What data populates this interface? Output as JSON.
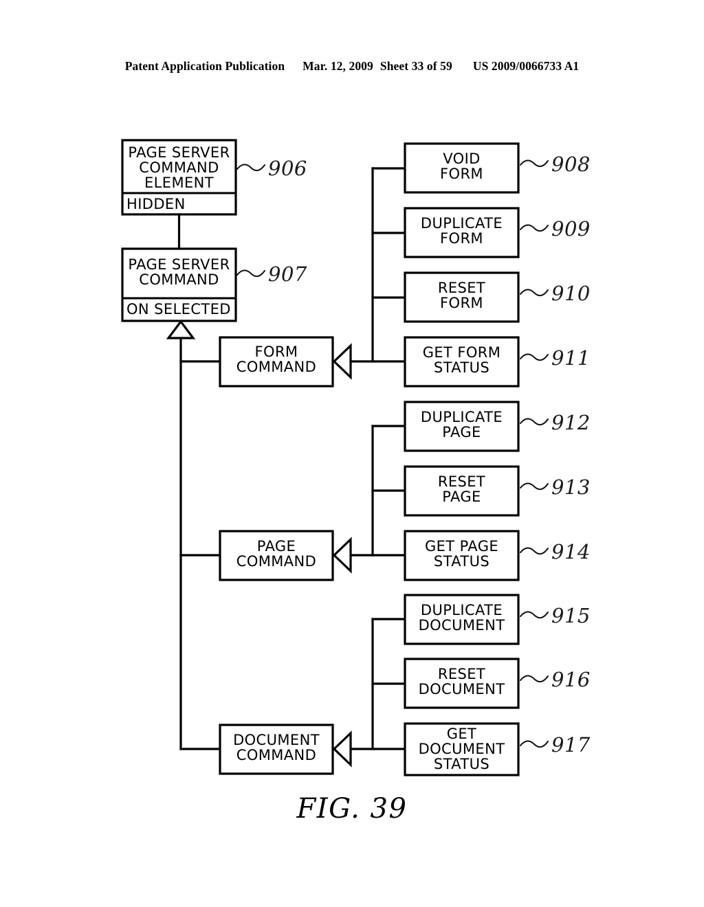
{
  "header": {
    "publication": "Patent Application Publication",
    "date": "Mar. 12, 2009",
    "sheet": "Sheet 33 of 59",
    "patent_number": "US 2009/0066733 A1"
  },
  "figure": {
    "caption": "FIG. 39"
  },
  "diagram": {
    "type": "uml-class-diagram",
    "classes": [
      {
        "id": "906",
        "name": "PAGE SERVER\nCOMMAND\nELEMENT",
        "name_lines": [
          "PAGE SERVER",
          "COMMAND",
          "ELEMENT"
        ],
        "attributes": [
          "HIDDEN"
        ],
        "ref": "906"
      },
      {
        "id": "907",
        "name": "PAGE SERVER\nCOMMAND",
        "name_lines": [
          "PAGE SERVER",
          "COMMAND"
        ],
        "attributes": [
          "ON SELECTED"
        ],
        "ref": "907"
      }
    ],
    "command_groups": [
      {
        "parent_label_lines": [
          "FORM",
          "COMMAND"
        ],
        "parent_name": "FORM COMMAND",
        "children": [
          {
            "ref": "908",
            "label_lines": [
              "VOID",
              "FORM"
            ],
            "label": "VOID FORM"
          },
          {
            "ref": "909",
            "label_lines": [
              "DUPLICATE",
              "FORM"
            ],
            "label": "DUPLICATE FORM"
          },
          {
            "ref": "910",
            "label_lines": [
              "RESET",
              "FORM"
            ],
            "label": "RESET FORM"
          },
          {
            "ref": "911",
            "label_lines": [
              "GET FORM",
              "STATUS"
            ],
            "label": "GET FORM STATUS"
          }
        ]
      },
      {
        "parent_label_lines": [
          "PAGE",
          "COMMAND"
        ],
        "parent_name": "PAGE COMMAND",
        "children": [
          {
            "ref": "912",
            "label_lines": [
              "DUPLICATE",
              "PAGE"
            ],
            "label": "DUPLICATE PAGE"
          },
          {
            "ref": "913",
            "label_lines": [
              "RESET",
              "PAGE"
            ],
            "label": "RESET PAGE"
          },
          {
            "ref": "914",
            "label_lines": [
              "GET PAGE",
              "STATUS"
            ],
            "label": "GET PAGE STATUS"
          }
        ]
      },
      {
        "parent_label_lines": [
          "DOCUMENT",
          "COMMAND"
        ],
        "parent_name": "DOCUMENT COMMAND",
        "children": [
          {
            "ref": "915",
            "label_lines": [
              "DUPLICATE",
              "DOCUMENT"
            ],
            "label": "DUPLICATE DOCUMENT"
          },
          {
            "ref": "916",
            "label_lines": [
              "RESET",
              "DOCUMENT"
            ],
            "label": "RESET DOCUMENT"
          },
          {
            "ref": "917",
            "label_lines": [
              "GET",
              "DOCUMENT",
              "STATUS"
            ],
            "label": "GET DOCUMENT STATUS"
          }
        ]
      }
    ]
  },
  "colors": {
    "stroke": "#000000",
    "fill": "#ffffff",
    "text": "#000000"
  }
}
